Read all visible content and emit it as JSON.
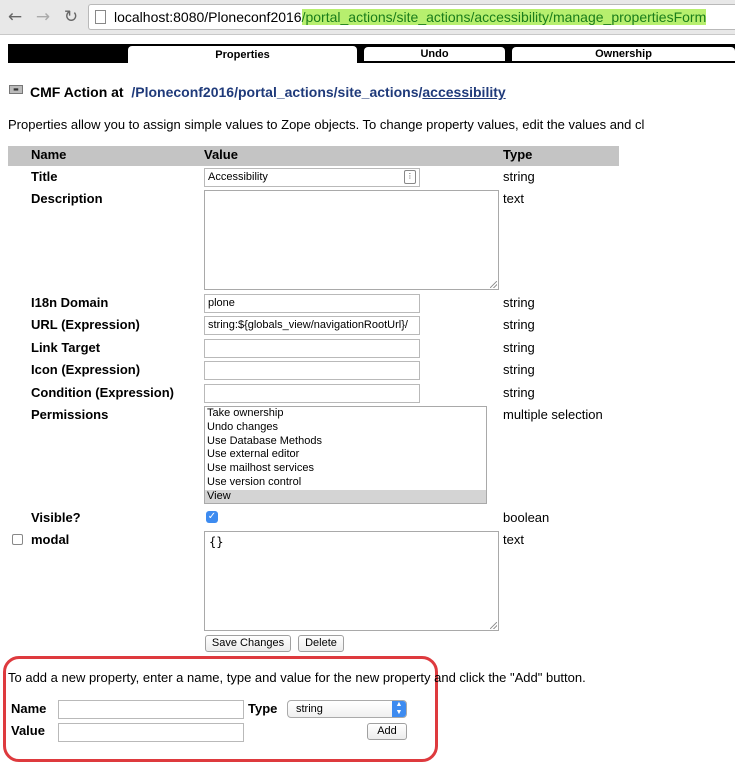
{
  "browser": {
    "url_host": "localhost:8080/Ploneconf2016",
    "url_path": "/portal_actions/site_actions/accessibility/manage_propertiesForm"
  },
  "tabs": [
    {
      "label": "Properties",
      "active": true
    },
    {
      "label": "Undo",
      "active": false
    },
    {
      "label": "Ownership",
      "active": false
    }
  ],
  "header": {
    "prefix": "CMF Action at",
    "crumbs": [
      "/Ploneconf2016",
      "/portal_actions",
      "/site_actions",
      "/accessibility"
    ]
  },
  "intro": "Properties allow you to assign simple values to Zope objects. To change property values, edit the values and cl",
  "table": {
    "headers": {
      "name": "Name",
      "value": "Value",
      "type": "Type"
    },
    "rows": [
      {
        "name": "Title",
        "value": "Accessibility",
        "type": "string"
      },
      {
        "name": "Description",
        "value": "",
        "type": "text"
      },
      {
        "name": "I18n Domain",
        "value": "plone",
        "type": "string"
      },
      {
        "name": "URL (Expression)",
        "value": "string:${globals_view/navigationRootUrl}/",
        "type": "string"
      },
      {
        "name": "Link Target",
        "value": "",
        "type": "string"
      },
      {
        "name": "Icon (Expression)",
        "value": "",
        "type": "string"
      },
      {
        "name": "Condition (Expression)",
        "value": "",
        "type": "string"
      },
      {
        "name": "Permissions",
        "type": "multiple selection"
      },
      {
        "name": "Visible?",
        "checked": true,
        "type": "boolean"
      },
      {
        "name": "modal",
        "value": "{}",
        "type": "text"
      }
    ],
    "permissions": {
      "options": [
        "Take ownership",
        "Undo changes",
        "Use Database Methods",
        "Use external editor",
        "Use mailhost services",
        "Use version control",
        "View"
      ],
      "selected": "View"
    }
  },
  "buttons": {
    "save": "Save Changes",
    "delete": "Delete",
    "add": "Add"
  },
  "add_property": {
    "instructions": "To add a new property, enter a name, type and value for the new property and click the \"Add\" button.",
    "name_label": "Name",
    "type_label": "Type",
    "value_label": "Value",
    "type_selected": "string",
    "name_value": "",
    "value_value": ""
  },
  "colors": {
    "highlight_box": "#de3a3e",
    "url_highlight": "#b7ef6e",
    "checkbox": "#3d8bf0"
  }
}
